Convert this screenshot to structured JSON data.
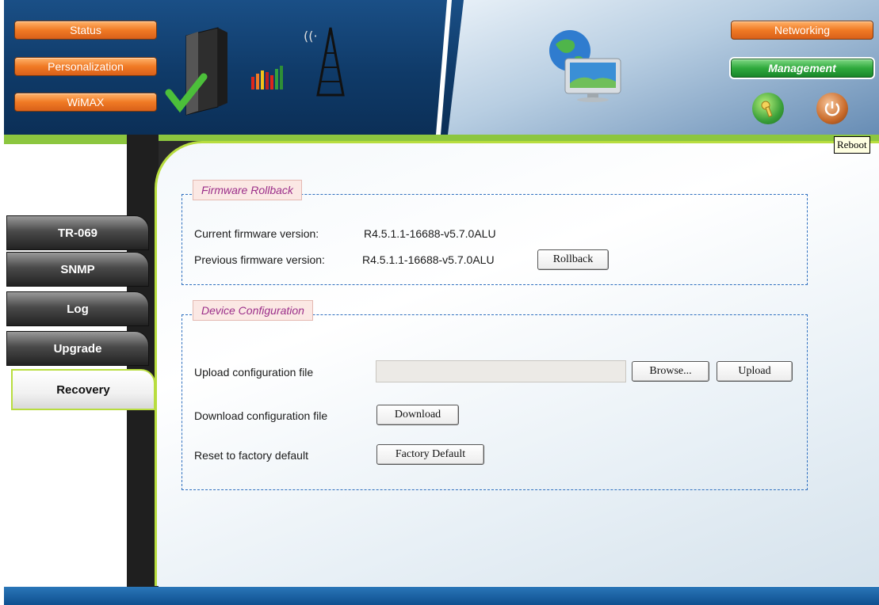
{
  "header": {
    "left_nav": [
      {
        "label": "Status"
      },
      {
        "label": "Personalization"
      },
      {
        "label": "WiMAX"
      }
    ],
    "right_nav": [
      {
        "label": "Networking"
      },
      {
        "label": "Management"
      }
    ],
    "icons": [
      "settings-key-icon",
      "power-reboot-icon"
    ],
    "tooltip": "Reboot"
  },
  "sidebar": {
    "items": [
      {
        "label": "TR-069"
      },
      {
        "label": "SNMP"
      },
      {
        "label": "Log"
      },
      {
        "label": "Upgrade"
      },
      {
        "label": "Recovery"
      }
    ],
    "selected": "Recovery"
  },
  "firmware_rollback": {
    "title": "Firmware Rollback",
    "current_label": "Current firmware version:",
    "current_value": "R4.5.1.1-16688-v5.7.0ALU",
    "previous_label": "Previous firmware version:",
    "previous_value": "R4.5.1.1-16688-v5.7.0ALU",
    "rollback_button": "Rollback"
  },
  "device_configuration": {
    "title": "Device Configuration",
    "upload_label": "Upload configuration file",
    "upload_value": "",
    "browse_button": "Browse...",
    "upload_button": "Upload",
    "download_label": "Download configuration file",
    "download_button": "Download",
    "reset_label": "Reset to factory default",
    "factory_button": "Factory Default"
  },
  "colors": {
    "header_blue": "#0f3a68",
    "accent_green": "#8cc63f",
    "nav_orange": "#f07a24",
    "nav_green": "#2faa3d",
    "legend_text": "#9b2f8a"
  }
}
